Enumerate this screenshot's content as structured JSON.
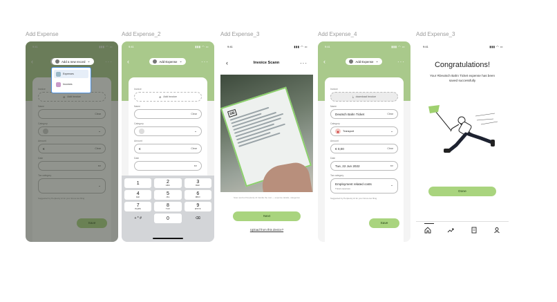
{
  "frames": [
    {
      "label": "Add Expense"
    },
    {
      "label": "Add Expense_2"
    },
    {
      "label": "Add Expense_3"
    },
    {
      "label": "Add Expense_4"
    },
    {
      "label": "Add Expense_3"
    }
  ],
  "status_time": "9:41",
  "common": {
    "add_expense_pill": "Add Expense",
    "invoice_label": "Invoice",
    "add_invoice": "Add invoice",
    "name_label": "Name",
    "category_label": "Category",
    "amount_label": "Amount",
    "date_label": "Date",
    "tax_label": "Tax category",
    "clear": "Clear",
    "euro": "€",
    "hint": "Suggested by Perplexity AI for your future tax filing",
    "save": "Save"
  },
  "screen1": {
    "pill": "Add a new record",
    "dropdown_items": [
      "Expenses",
      "Incomes"
    ]
  },
  "screen2": {
    "keys": [
      [
        {
          "n": "1",
          "l": ""
        },
        {
          "n": "2",
          "l": "ABC"
        },
        {
          "n": "3",
          "l": "DEF"
        }
      ],
      [
        {
          "n": "4",
          "l": "GHI"
        },
        {
          "n": "5",
          "l": "JKL"
        },
        {
          "n": "6",
          "l": "MNO"
        }
      ],
      [
        {
          "n": "7",
          "l": "PQRS"
        },
        {
          "n": "8",
          "l": "TUV"
        },
        {
          "n": "9",
          "l": "WXYZ"
        }
      ]
    ],
    "symbols": "+ * #",
    "zero": "0",
    "backspace": "⌫"
  },
  "screen3": {
    "title": "Invoice Scann",
    "hint": "Scan and let Perplexity AI handle the rest — expense details, categories",
    "next": "Next",
    "upload": "Upload from this device?"
  },
  "screen4": {
    "download_invoice": "download Invoice",
    "name_value": "Deutsch Bahn Ticket",
    "category_value": "Transport",
    "amount_value": "€ 0,00",
    "date_value": "Tue, 22 Jun 2022",
    "tax_value": "Employment related costs",
    "tax_sub": "Travel expenses"
  },
  "screen5": {
    "title": "Congratulations!",
    "message": "Your #Deutsch Bahn Ticket expense has been saved successfully",
    "done": "Done"
  },
  "colors": {
    "accent_green": "#a9c98b",
    "button_green": "#a9d47e",
    "selection_blue": "#4a8fe0"
  }
}
